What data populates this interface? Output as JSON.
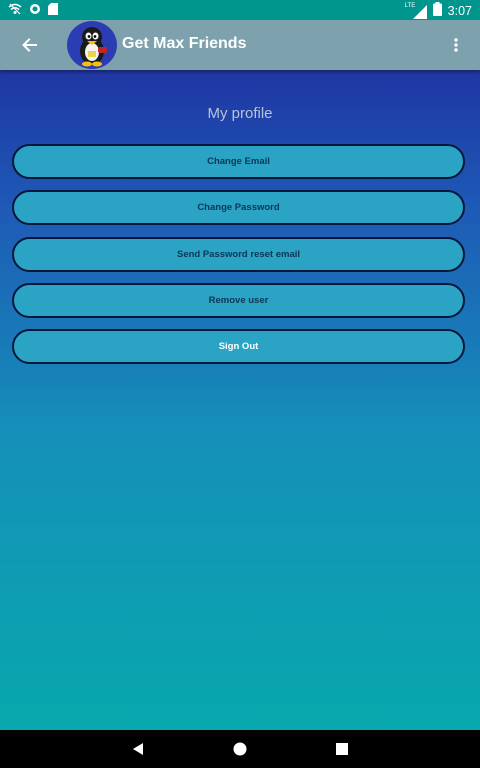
{
  "status_bar": {
    "time": "3:07",
    "network_label": "LTE",
    "left_icons": [
      "wifi-off-icon",
      "sync-icon",
      "sd-card-icon"
    ],
    "right_icons": [
      "signal-icon",
      "battery-icon"
    ]
  },
  "app_bar": {
    "title": "Get Max Friends",
    "back_icon": "arrow-back-icon",
    "menu_icon": "more-vert-icon",
    "avatar_icon": "penguin-icon"
  },
  "profile": {
    "title": "My profile",
    "buttons": [
      {
        "label": "Change Email"
      },
      {
        "label": "Change Password"
      },
      {
        "label": "Send Password reset email"
      },
      {
        "label": "Remove user"
      },
      {
        "label": "Sign Out"
      }
    ]
  },
  "nav_bar": {
    "icons": [
      "back-triangle-icon",
      "home-circle-icon",
      "recents-square-icon"
    ]
  },
  "colors": {
    "status_bar": "#00968e",
    "app_bar": "#7da2ad",
    "gradient_top": "#1f36a3",
    "gradient_bottom": "#07a8ad",
    "button_fill": "#2aa3c4",
    "button_border": "#061638"
  }
}
